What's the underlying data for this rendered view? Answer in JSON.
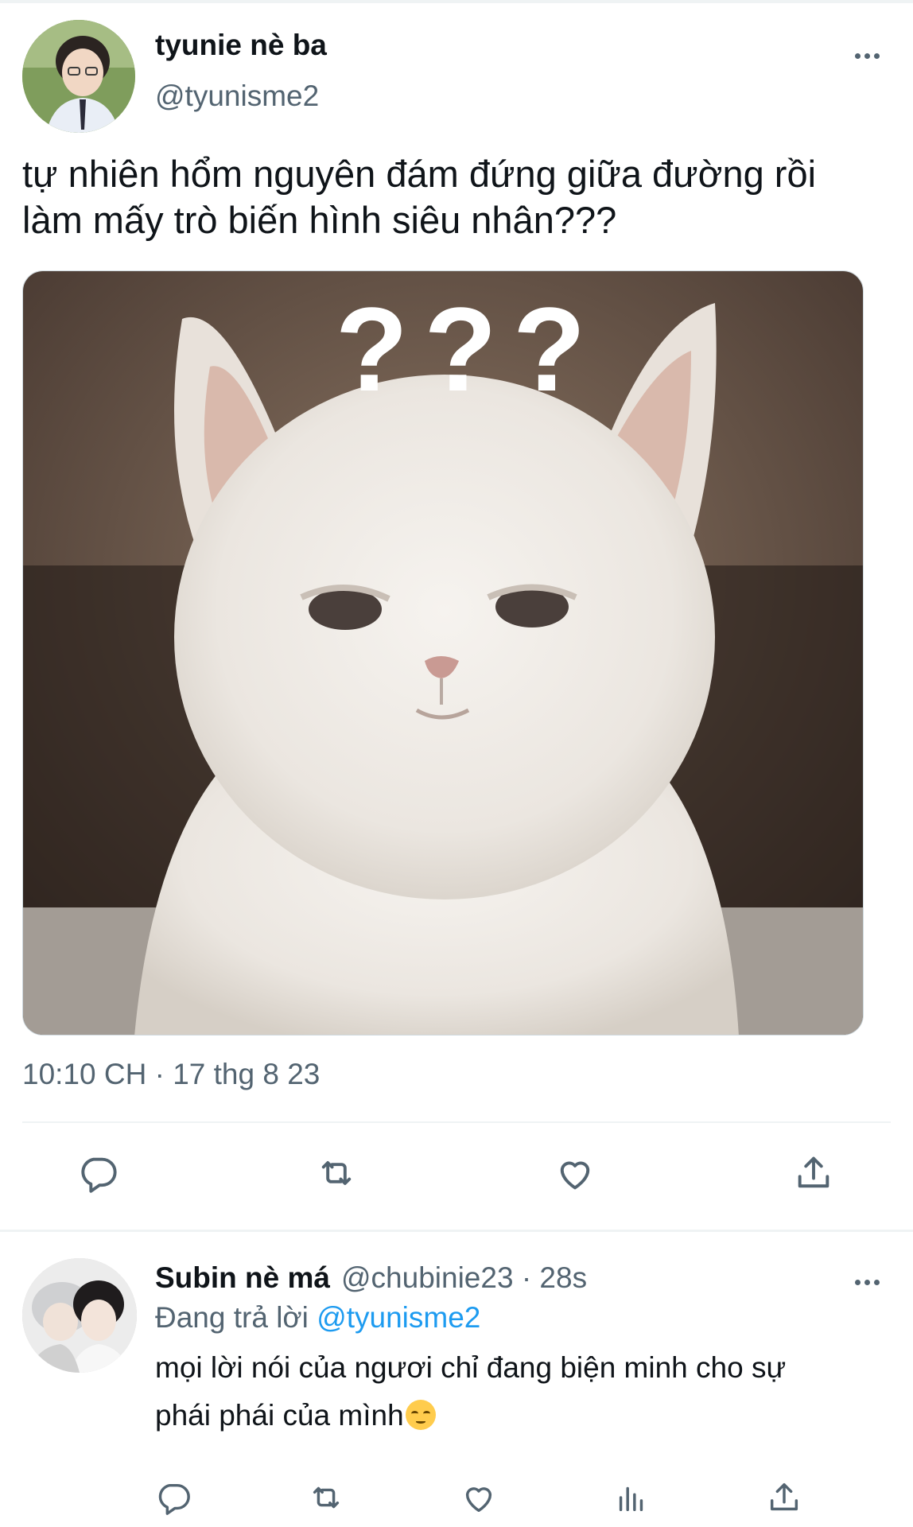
{
  "main_tweet": {
    "author_name": "tyunie nè ba",
    "author_handle": "@tyunisme2",
    "text": "tự nhiên hổm nguyên đám đứng giữa đường rồi\nlàm mấy trò biến hình siêu nhân???",
    "media": {
      "overlay_text": "???"
    },
    "timestamp": "10:10 CH · 17 thg 8 23",
    "actions": [
      "reply-icon",
      "retweet-icon",
      "like-icon",
      "share-icon"
    ]
  },
  "reply": {
    "author_name": "Subin nè má",
    "author_handle": "@chubinie23",
    "time_ago": "· 28s",
    "replying_to_prefix": "Đang trả lời",
    "replying_to_handle": "@tyunisme2",
    "text": "mọi lời nói của ngươi chỉ đang biện minh cho sự\nphái phái của mình",
    "actions": [
      "reply-icon",
      "retweet-icon",
      "like-icon",
      "views-icon",
      "share-icon"
    ]
  },
  "colors": {
    "text_primary": "#0f1419",
    "text_secondary": "#536471",
    "link": "#1d9bf0",
    "divider": "#eff3f4"
  }
}
